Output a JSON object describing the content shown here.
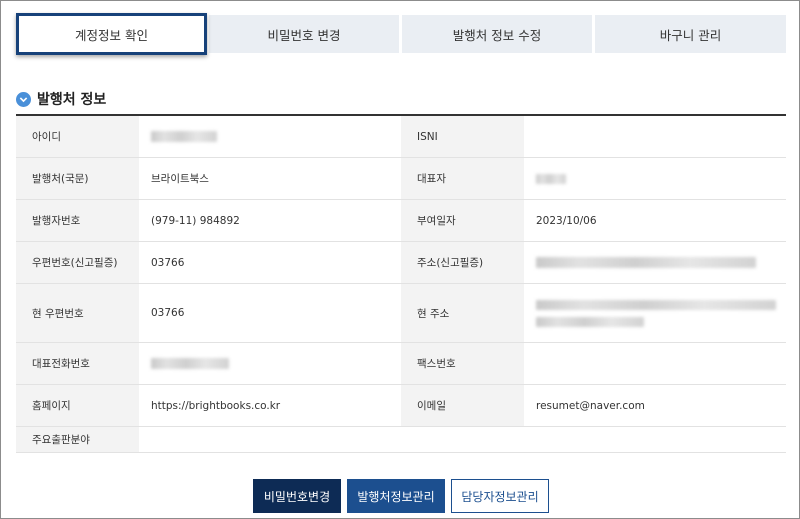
{
  "tabs": [
    {
      "label": "계정정보 확인",
      "active": true
    },
    {
      "label": "비밀번호 변경",
      "active": false
    },
    {
      "label": "발행처 정보 수정",
      "active": false
    },
    {
      "label": "바구니 관리",
      "active": false
    }
  ],
  "section": {
    "title": "발행처 정보",
    "icon": "chevron-down-circle-icon"
  },
  "info": {
    "id_label": "아이디",
    "isni_label": "ISNI",
    "isni_value": "",
    "publisher_label": "발행처(국문)",
    "publisher_value": "브라이트북스",
    "ceo_label": "대표자",
    "pubno_label": "발행자번호",
    "pubno_value": "(979-11) 984892",
    "grant_label": "부여일자",
    "grant_value": "2023/10/06",
    "zip_label": "우편번호(신고필증)",
    "zip_value": "03766",
    "addr_label": "주소(신고필증)",
    "curzip_label": "현 우편번호",
    "curzip_value": "03766",
    "curaddr_label": "현 주소",
    "phone_label": "대표전화번호",
    "fax_label": "팩스번호",
    "fax_value": "",
    "homepage_label": "홈페이지",
    "homepage_value": "https://brightbooks.co.kr",
    "email_label": "이메일",
    "email_value": "resumet@naver.com",
    "field_label": "주요출판분야",
    "field_value": ""
  },
  "buttons": {
    "change_pw": "비밀번호변경",
    "publisher_manage": "발행처정보관리",
    "manager_manage": "담당자정보관리"
  },
  "colors": {
    "tab_active_border": "#17427a",
    "tab_bg": "#eaeef3",
    "btn_dark": "#0d2b55",
    "btn_mid": "#1c4f8f",
    "icon": "#4a90d9"
  }
}
